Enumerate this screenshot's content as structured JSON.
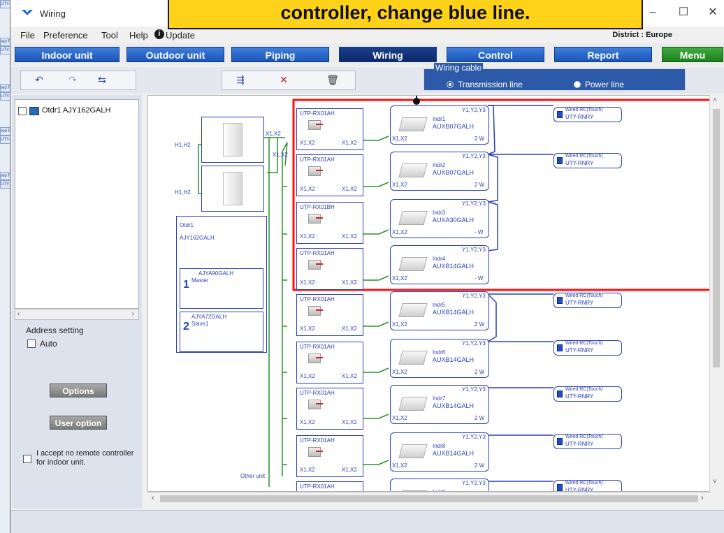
{
  "callout": {
    "text": "controller, change blue line."
  },
  "window": {
    "title": "Wiring"
  },
  "window_controls": {
    "minimize": "–",
    "maximize": "☐",
    "close": "✕"
  },
  "menu": {
    "file": "File",
    "preference": "Preference",
    "tool": "Tool",
    "help": "Help",
    "update": "Update",
    "district": "District : Europe"
  },
  "nav": {
    "indoor": "Indoor unit",
    "outdoor": "Outdoor unit",
    "piping": "Piping",
    "wiring": "Wiring",
    "control": "Control",
    "report": "Report",
    "menu": "Menu"
  },
  "toolbar": {
    "cable_legend": "Wiring cable",
    "transmission": "Transmission line",
    "power": "Power line"
  },
  "left_panel": {
    "tree_item": "Otdr1 AJY162GALH",
    "address_setting": "Address setting",
    "auto": "Auto",
    "options": "Options",
    "user_option": "User option",
    "accept": "I accept no remote controller for indoor unit."
  },
  "bg_tags": [
    "UTY-RNRY",
    "red F",
    "UTY-F",
    "red F",
    "UTY-F",
    "red F",
    "UTY-F",
    "red F",
    "UTY-F"
  ],
  "diagram": {
    "outdoor": {
      "name": "Otdr1",
      "model": "AJY162GALH",
      "unit1_model": "AJYA90GALH",
      "unit1_role": "Master",
      "unit1_no": "1",
      "unit2_model": "AJYA72GALH",
      "unit2_role": "Slave1",
      "unit2_no": "2",
      "h_label": "H1,H2",
      "x_label": "X1,X2",
      "other_unit": "Other unit"
    },
    "adapters": [
      {
        "model": "UTP-RX01AH",
        "left": "X1,X2",
        "right": "X1,X2"
      },
      {
        "model": "UTP-RX01AH",
        "left": "X1,X2",
        "right": "X1,X2"
      },
      {
        "model": "UTP-RX01BH",
        "left": "X1,X2",
        "right": "X1,X2"
      },
      {
        "model": "UTP-RX01AH",
        "left": "X1,X2",
        "right": "X1,X2"
      },
      {
        "model": "UTP-RX01AH",
        "left": "X1,X2",
        "right": "X1,X2"
      },
      {
        "model": "UTP-RX01AH",
        "left": "X1,X2",
        "right": "X1,X2"
      },
      {
        "model": "UTP-RX01AH",
        "left": "X1,X2",
        "right": "X1,X2"
      },
      {
        "model": "UTP-RX01AH",
        "left": "X1,X2",
        "right": "X1,X2"
      },
      {
        "model": "UTP-RX01AH",
        "left": "",
        "right": ""
      }
    ],
    "indoor": [
      {
        "name": "Indr1",
        "model": "AUXB07GALH",
        "terminal": "Y1,Y2,Y3",
        "x": "X1,X2",
        "wire": "2 W"
      },
      {
        "name": "Indr2",
        "model": "AUXB07GALH",
        "terminal": "Y1,Y2,Y3",
        "x": "X1,X2",
        "wire": "2 W"
      },
      {
        "name": "Indr3",
        "model": "AUXA30GALH",
        "terminal": "Y1,Y2,Y3",
        "x": "X1,X2",
        "wire": "- W"
      },
      {
        "name": "Indr4",
        "model": "AUXB14GALH",
        "terminal": "Y1,Y2,Y3",
        "x": "X1,X2",
        "wire": "- W"
      },
      {
        "name": "Indr5",
        "model": "AUXB14GALH",
        "terminal": "Y1,Y2,Y3",
        "x": "X1,X2",
        "wire": "2 W"
      },
      {
        "name": "Indr6",
        "model": "AUXB14GALH",
        "terminal": "Y1,Y2,Y3",
        "x": "X1,X2",
        "wire": "2 W"
      },
      {
        "name": "Indr7",
        "model": "AUXB14GALH",
        "terminal": "Y1,Y2,Y3",
        "x": "X1,X2",
        "wire": "2 W"
      },
      {
        "name": "Indr8",
        "model": "AUXB14GALH",
        "terminal": "Y1,Y2,Y3",
        "x": "X1,X2",
        "wire": "2 W"
      },
      {
        "name": "Indr9",
        "model": "",
        "terminal": "Y1,Y2,Y3",
        "x": "",
        "wire": ""
      }
    ],
    "remote": {
      "type": "Wired RC(Touch)",
      "model": "UTY-RNRY"
    }
  },
  "colors": {
    "highlight": "#ff1010",
    "callout_bg": "#ffd21a",
    "transmission_line": "#2b3fb4",
    "power_line": "#2a8f2a"
  }
}
